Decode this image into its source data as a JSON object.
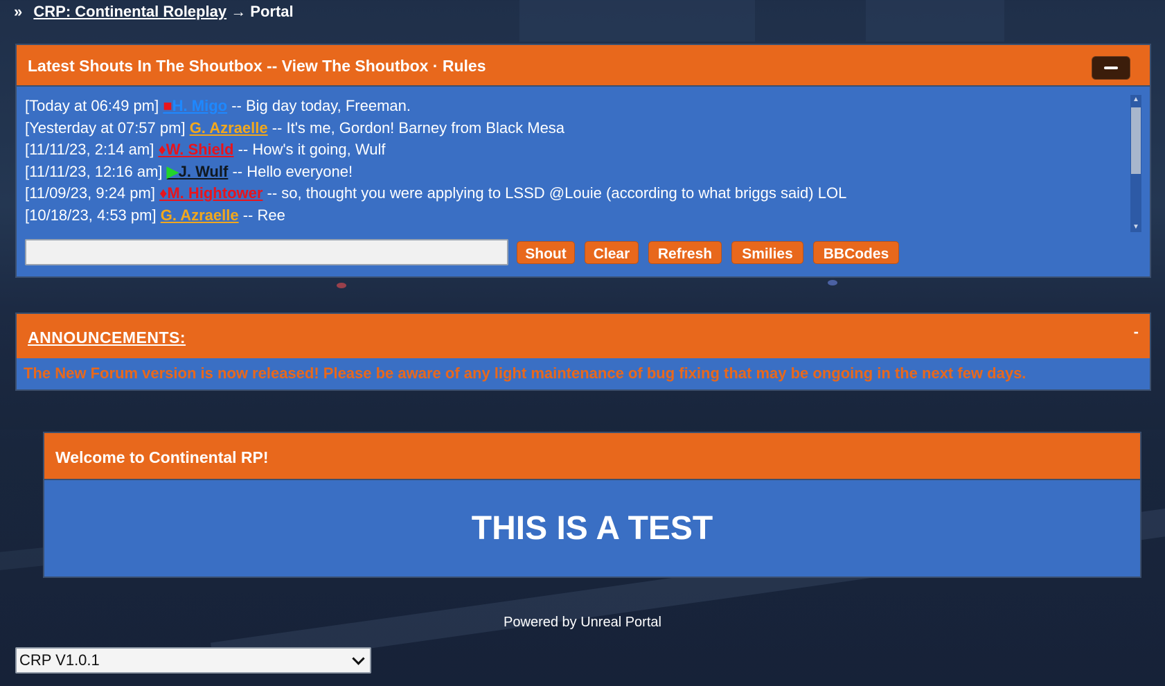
{
  "breadcrumb": {
    "separator": "»",
    "forum_link": "CRP: Continental Roleplay",
    "current": "→ Portal"
  },
  "shoutbox": {
    "title": "Latest Shouts In The Shoutbox -- View The Shoutbox · Rules",
    "shouts": [
      {
        "time": "[Today at 06:49 pm]",
        "icon": "■",
        "icon_color": "#e8141c",
        "user": "H. Migo",
        "user_color": "#1e88ff",
        "message": " -- Big day today, Freeman."
      },
      {
        "time": "[Yesterday at 07:57 pm]",
        "icon": "",
        "icon_color": "#f2a81d",
        "user": "G. Azraelle",
        "user_color": "#f2a81d",
        "message": " -- It's me, Gordon! Barney from Black Mesa"
      },
      {
        "time": "[11/11/23, 2:14 am]",
        "icon": "♦",
        "icon_color": "#e8141c",
        "user": "W. Shield",
        "user_color": "#e8141c",
        "message": " -- How's it going, Wulf"
      },
      {
        "time": "[11/11/23, 12:16 am]",
        "icon": "▶",
        "icon_color": "#22d42a",
        "user": "J. Wulf",
        "user_color": "#101820",
        "message": " -- Hello everyone!"
      },
      {
        "time": "[11/09/23, 9:24 pm]",
        "icon": "♦",
        "icon_color": "#e8141c",
        "user": "M. Hightower",
        "user_color": "#e8141c",
        "message": " -- so, thought you were applying to LSSD @Louie (according to what briggs said) LOL"
      },
      {
        "time": "[10/18/23, 4:53 pm]",
        "icon": "",
        "icon_color": "#f2a81d",
        "user": "G. Azraelle",
        "user_color": "#f2a81d",
        "message": " -- Ree"
      }
    ],
    "input_value": "",
    "buttons": {
      "shout": "Shout",
      "clear": "Clear",
      "refresh": "Refresh",
      "smilies": "Smilies",
      "bbcodes": "BBCodes"
    }
  },
  "announcements": {
    "title": "ANNOUNCEMENTS:",
    "collapse": "-",
    "text": "The New Forum version is now released! Please be aware of any light maintenance of bug fixing that may be ongoing in the next few days."
  },
  "welcome": {
    "title": "Welcome to Continental RP!",
    "body": "THIS IS A TEST"
  },
  "footer": {
    "powered": "Powered by Unreal Portal",
    "version_selected": "CRP V1.0.1"
  },
  "colors": {
    "orange": "#e8681c",
    "panel_blue": "#3a6fc4",
    "background": "#1f2f49"
  }
}
